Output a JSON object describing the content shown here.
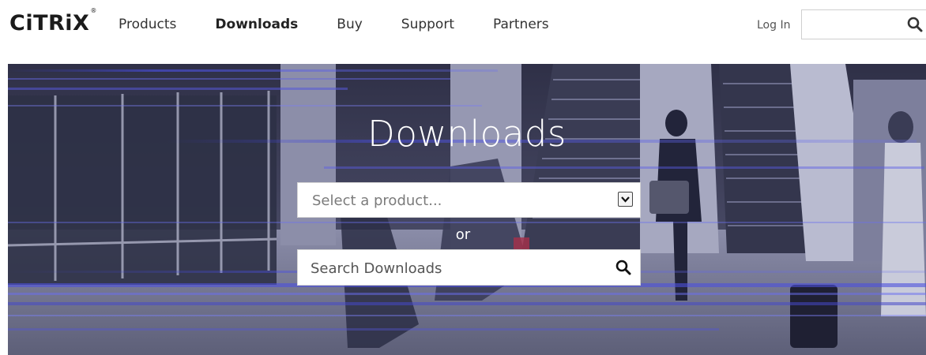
{
  "brand": {
    "name": "CiTRiX",
    "mark": "®"
  },
  "nav": {
    "items": [
      {
        "label": "Products",
        "active": false
      },
      {
        "label": "Downloads",
        "active": true
      },
      {
        "label": "Buy",
        "active": false
      },
      {
        "label": "Support",
        "active": false
      },
      {
        "label": "Partners",
        "active": false
      }
    ],
    "login_label": "Log In",
    "search_placeholder": ""
  },
  "hero": {
    "title": "Downloads",
    "product_select_placeholder": "Select a product...",
    "or_label": "or",
    "search_placeholder": "Search Downloads"
  },
  "icons": {
    "top_search": "search-icon",
    "hero_search": "search-icon",
    "dropdown": "chevron-down-icon"
  },
  "colors": {
    "hero_base": "#5a5d7c",
    "hero_streak": "#4a4fd0",
    "text_dark": "#222222"
  }
}
